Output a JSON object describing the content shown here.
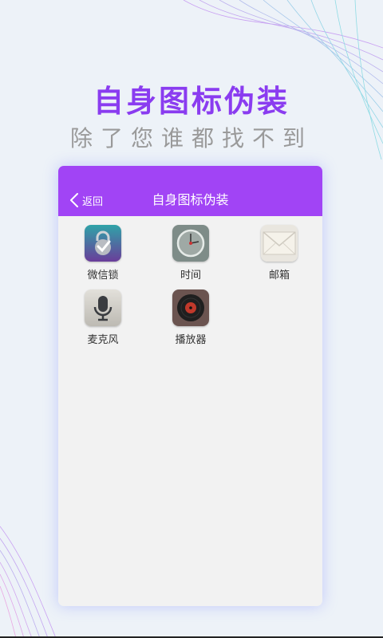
{
  "promo": {
    "title": "自身图标伪装",
    "subtitle": "除了您谁都找不到"
  },
  "app_bar": {
    "back_label": "返回",
    "title": "自身图标伪装"
  },
  "apps": [
    {
      "label": "微信锁",
      "icon": "padlock-check-icon"
    },
    {
      "label": "时间",
      "icon": "clock-icon"
    },
    {
      "label": "邮箱",
      "icon": "envelope-icon"
    },
    {
      "label": "麦克风",
      "icon": "microphone-icon"
    },
    {
      "label": "播放器",
      "icon": "vinyl-record-icon"
    }
  ],
  "colors": {
    "accent": "#a144f5",
    "headline": "#8a3cf0",
    "background": "#edf2f8"
  }
}
